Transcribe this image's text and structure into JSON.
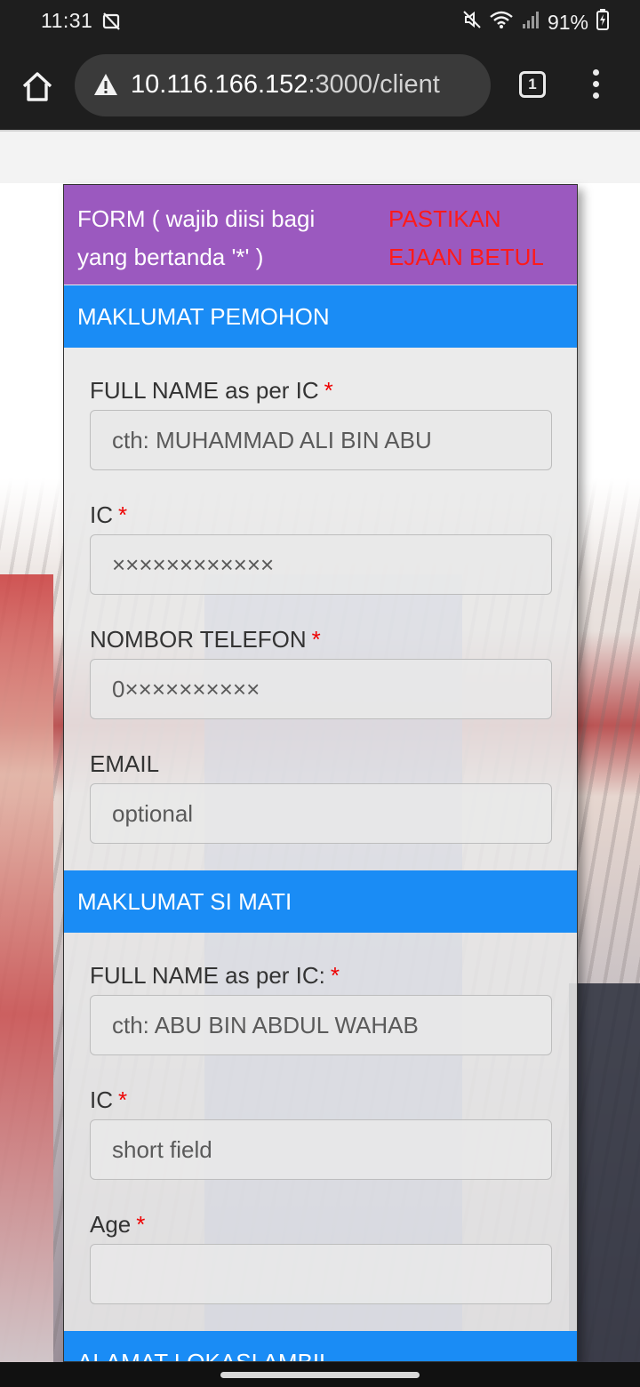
{
  "status_bar": {
    "time": "11:31",
    "battery": "91%"
  },
  "browser": {
    "url_host": "10.116.166.152",
    "url_rest": ":3000/client",
    "tab_count": "1"
  },
  "form": {
    "header_text": "FORM ( wajib diisi bagi yang bertanda '*' )",
    "warning_text": "PASTIKAN EJAAN BETUL",
    "required_mark": "*",
    "section_pemohon": "MAKLUMAT PEMOHON",
    "pemohon_fields": [
      {
        "label": "FULL NAME as per IC",
        "placeholder": "cth: MUHAMMAD ALI BIN ABU",
        "required": true
      },
      {
        "label": "IC",
        "placeholder": "××××××××××××",
        "required": true
      },
      {
        "label": "NOMBOR TELEFON",
        "placeholder": "0××××××××××",
        "required": true
      },
      {
        "label": "EMAIL",
        "placeholder": "optional",
        "required": false
      }
    ],
    "section_si_mati": "MAKLUMAT SI MATI",
    "si_mati_fields": [
      {
        "label": "FULL NAME as per IC:",
        "placeholder": "cth: ABU BIN ABDUL WAHAB",
        "required": true
      },
      {
        "label": "IC",
        "placeholder": "short field",
        "required": true
      },
      {
        "label": "Age",
        "placeholder": "",
        "required": true
      }
    ],
    "section_alamat": "ALAMAT LOKASI AMBIL"
  },
  "colors": {
    "form_header_bg": "#9b59bf",
    "section_bg": "#1a8cf5",
    "warning": "#ff1a1a",
    "required": "#e00000"
  }
}
